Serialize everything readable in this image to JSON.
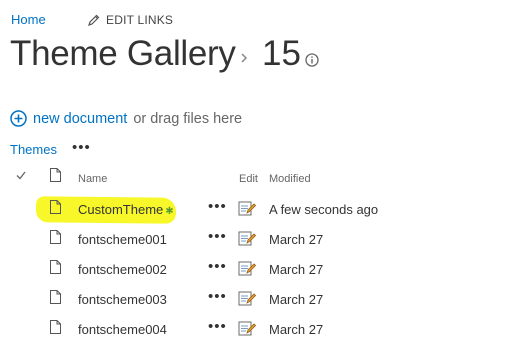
{
  "breadcrumb": {
    "home": "Home",
    "edit_links": "EDIT LINKS"
  },
  "page": {
    "title": "Theme Gallery",
    "count": "15"
  },
  "toolbar": {
    "new_document": "new document",
    "drag_text": "or drag files here"
  },
  "view": {
    "current": "Themes",
    "more": "•••"
  },
  "columns": {
    "name": "Name",
    "edit": "Edit",
    "modified": "Modified"
  },
  "rows": [
    {
      "name": "CustomTheme",
      "new_marker": "✱",
      "modified": "A few seconds ago",
      "highlighted": true
    },
    {
      "name": "fontscheme001",
      "modified": "March 27"
    },
    {
      "name": "fontscheme002",
      "modified": "March 27"
    },
    {
      "name": "fontscheme003",
      "modified": "March 27"
    },
    {
      "name": "fontscheme004",
      "modified": "March 27"
    }
  ],
  "row_menu": "•••",
  "colors": {
    "accent": "#0072c6",
    "highlight": "#f7f72a",
    "new_marker": "#5aa02c"
  }
}
